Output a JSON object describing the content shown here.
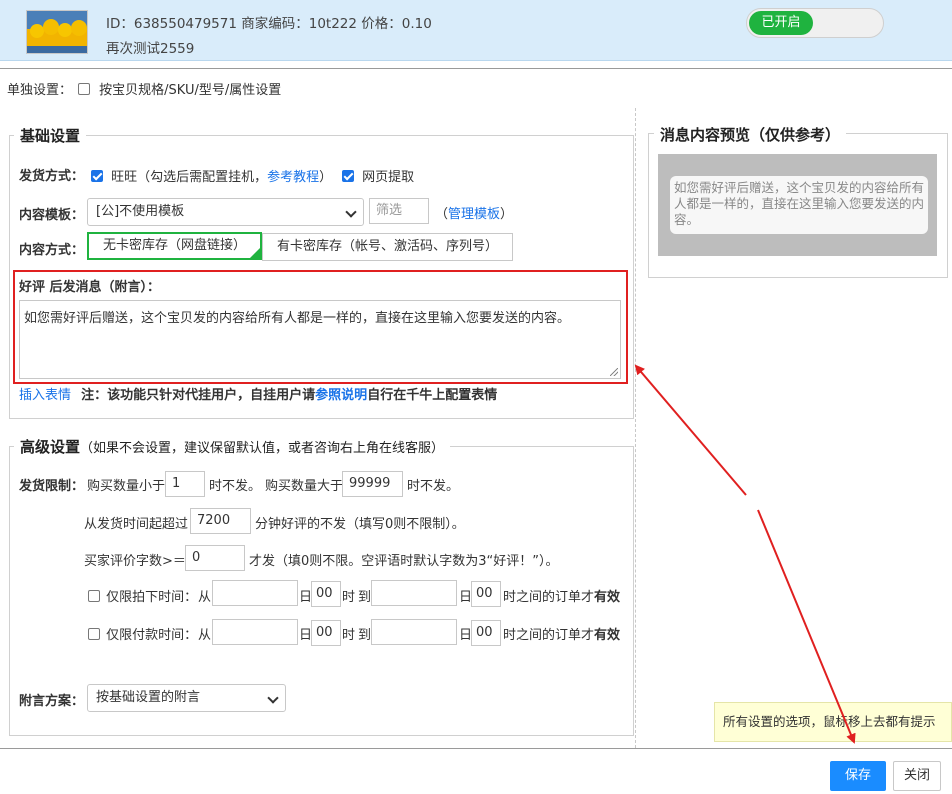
{
  "header": {
    "info_line1": "ID：638550479571 商家编码：10t222 价格：0.10",
    "info_line2": "再次测试2559",
    "toggle_label": "已开启"
  },
  "single_setting": {
    "label": "单独设置：",
    "checkbox_label": "按宝贝规格/SKU/型号/属性设置"
  },
  "basic": {
    "legend": "基础设置",
    "delivery_label": "发货方式：",
    "wangwang_label": "旺旺（勾选后需配置挂机，",
    "tutorial_link": "参考教程",
    "wangwang_tail": "）",
    "web_label": "网页提取",
    "template_label": "内容模板：",
    "template_value": "[公]不使用模板",
    "filter_placeholder": "筛选",
    "manage_open": "（",
    "manage_link": "管理模板",
    "manage_close": "）",
    "content_label": "内容方式：",
    "content_options": [
      "无卡密库存（网盘链接）",
      "有卡密库存（帐号、激活码、序列号）"
    ],
    "message_label": "好评 后发消息（附言）：",
    "message_value": "如您需好评后赠送，这个宝贝发的内容给所有人都是一样的，直接在这里输入您要发送的内容。",
    "insert_emoji": "插入表情",
    "note_prefix": "注：该功能只针对代挂用户，自挂用户请",
    "note_link": "参照说明",
    "note_suffix": "自行在千牛上配置表情"
  },
  "advanced": {
    "legend": "高级设置",
    "legend_sub": "（如果不会设置，建议保留默认值，或者咨询右上角在线客服）",
    "limit_label": "发货限制：",
    "qty_less_prefix": "购买数量小于",
    "qty_less_value": "1",
    "qty_less_suffix": "时不发。",
    "qty_more_prefix": "购买数量大于",
    "qty_more_value": "99999",
    "qty_more_suffix": "时不发。",
    "time_prefix": "从发货时间起超过",
    "time_value": "7200",
    "time_suffix": "分钟好评的不发（填写0则不限制）。",
    "words_prefix": "买家评价字数>＝",
    "words_value": "0",
    "words_suffix": "才发（填0则不限。空评语时默认字数为3“好评！”）。",
    "order_time_label": "仅限拍下时间：",
    "pay_time_label": "仅限付款时间：",
    "from": "从",
    "day": "日",
    "hour": "00",
    "hour_unit": "时",
    "to": "到",
    "valid_suffix_plain": "时之间的订单才",
    "valid_suffix_bold": "有效",
    "note_label": "附言方案：",
    "note_value": "按基础设置的附言"
  },
  "preview": {
    "legend": "消息内容预览（仅供参考）",
    "text": "如您需好评后赠送，这个宝贝发的内容给所有人都是一样的，直接在这里输入您要发送的内容。"
  },
  "tooltip": "所有设置的选项，鼠标移上去都有提示",
  "footer": {
    "save": "保存",
    "close": "关闭"
  },
  "colors": {
    "header_bg": "#d9ecfa",
    "toggle_on": "#1fb33f",
    "link": "#1a73e8",
    "highlight_red": "#e02020",
    "save_button": "#1a8cff",
    "tooltip_bg": "#ffffd6"
  }
}
